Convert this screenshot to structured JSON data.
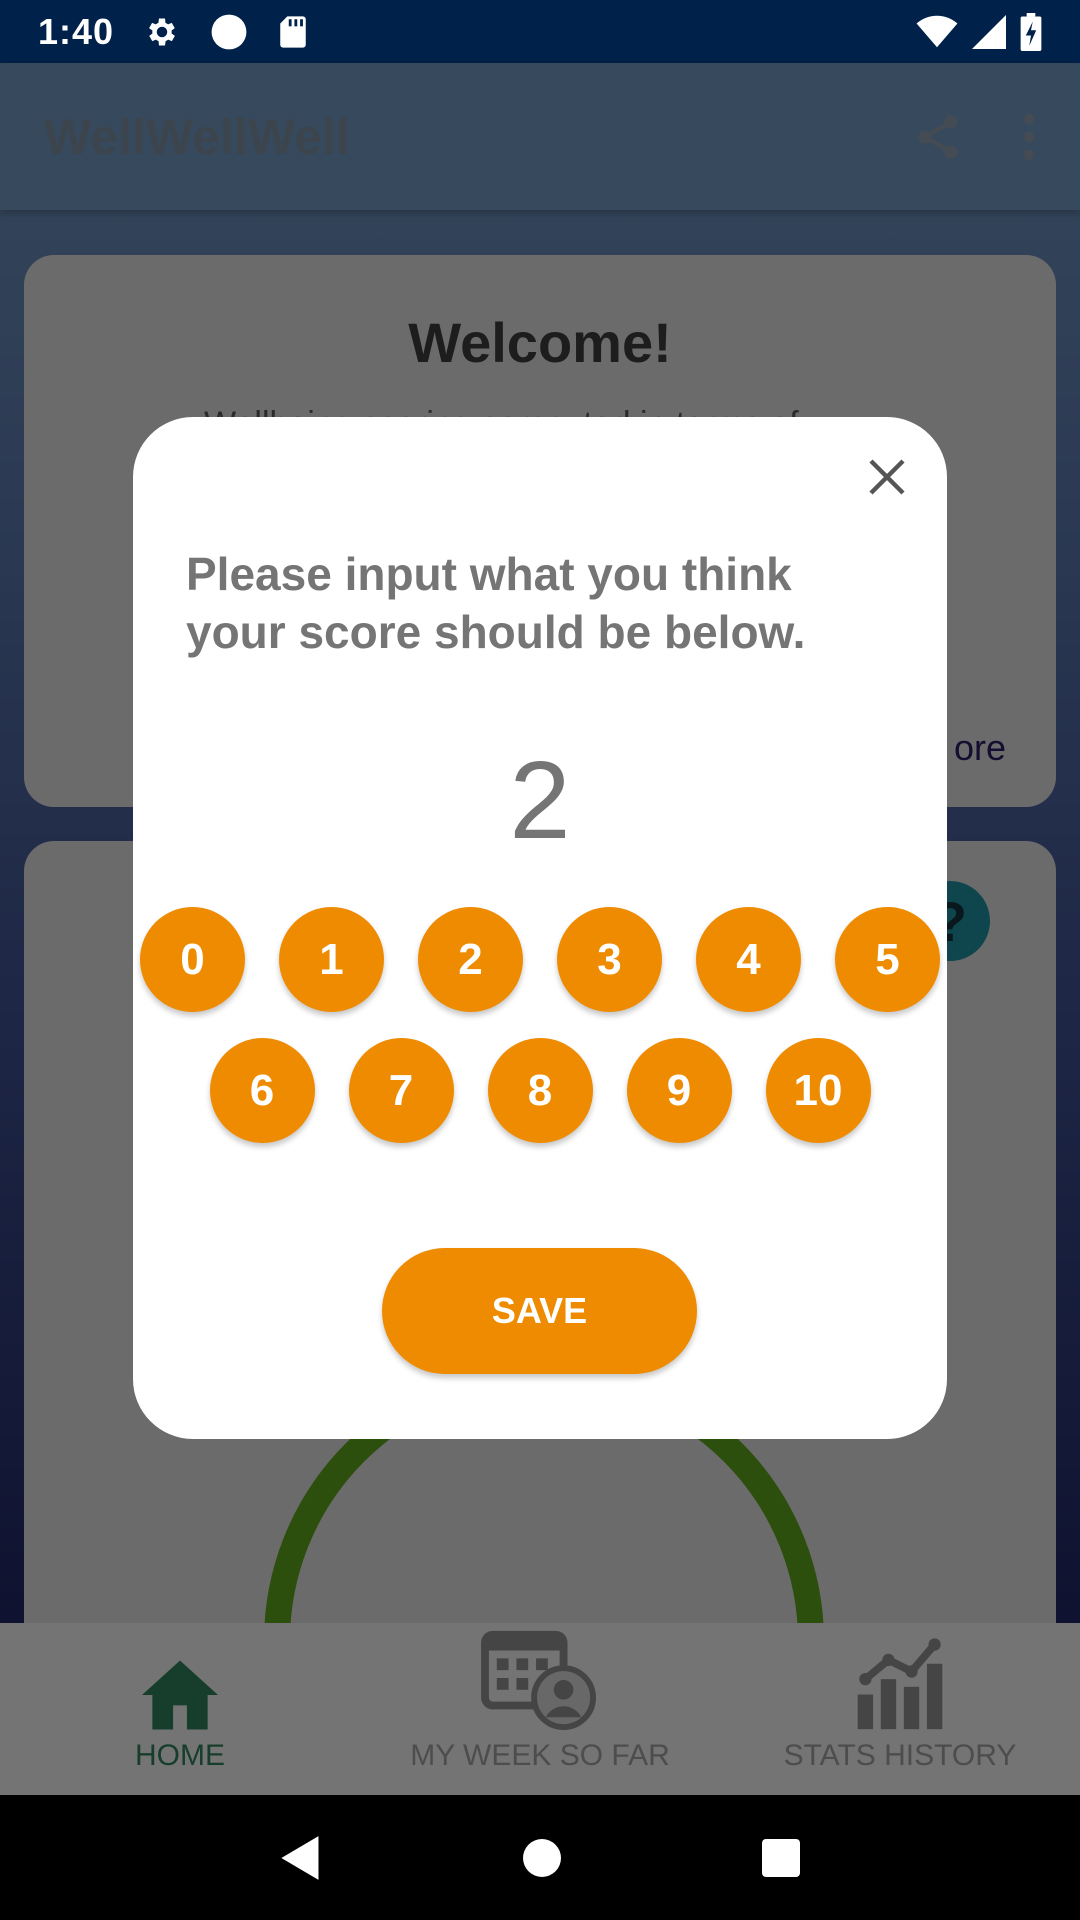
{
  "status_bar": {
    "time": "1:40",
    "left_icons": [
      "gear-icon",
      "circle-icon",
      "sd-card-icon"
    ],
    "right_icons": [
      "wifi-icon",
      "signal-icon",
      "battery-charging-icon"
    ]
  },
  "app_bar": {
    "title": "WellWellWell",
    "actions": [
      "share-icon",
      "more-vert-icon"
    ]
  },
  "welcome_card": {
    "title": "Welcome!",
    "text": "Wellbeing scoring computed in terms of",
    "link": "ore"
  },
  "score_card": {
    "help_glyph": "?"
  },
  "dialog": {
    "prompt": "Please input what you think your score should be below.",
    "current_value": "2",
    "buttons_row1": [
      "0",
      "1",
      "2",
      "3",
      "4",
      "5"
    ],
    "buttons_row2": [
      "6",
      "7",
      "8",
      "9",
      "10"
    ],
    "save_label": "SAVE"
  },
  "bottom_nav": {
    "items": [
      {
        "label": "HOME",
        "icon": "home-icon",
        "active": true
      },
      {
        "label": "MY WEEK SO FAR",
        "icon": "calendar-user-icon",
        "active": false
      },
      {
        "label": "STATS HISTORY",
        "icon": "chart-icon",
        "active": false
      }
    ]
  },
  "colors": {
    "accent": "#ee8b00",
    "status_bar": "#00224a",
    "nav_active": "#2e7d5b",
    "score_ring": "#5a9e1a"
  }
}
